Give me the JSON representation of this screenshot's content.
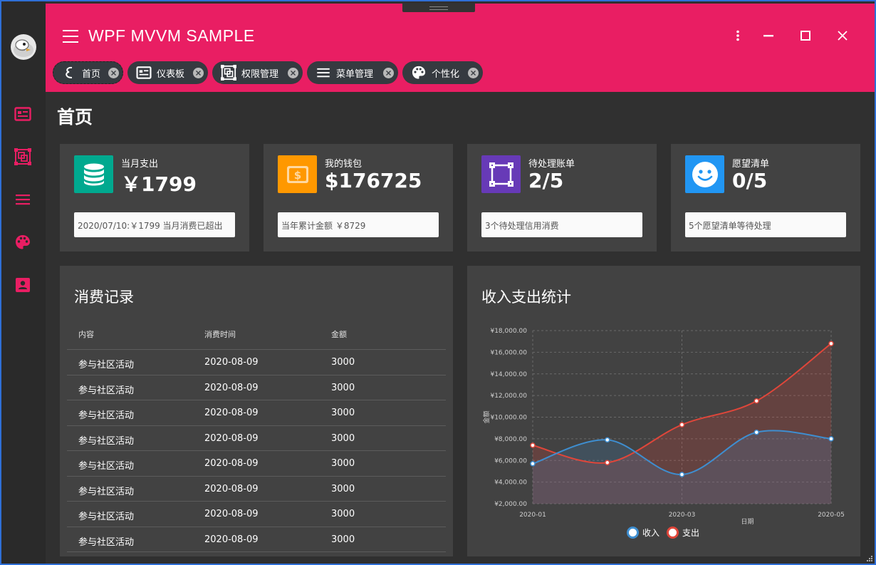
{
  "app": {
    "title": "WPF MVVM SAMPLE"
  },
  "colors": {
    "accent": "#e91e63",
    "card_teal": "#00a98f",
    "card_orange": "#ff9800",
    "card_purple": "#673ab7",
    "card_blue": "#2196f3",
    "income": "#3e8ed0",
    "expense": "#e0463a"
  },
  "sidebar": {
    "items": [
      {
        "icon": "dashboard-icon"
      },
      {
        "icon": "permission-icon"
      },
      {
        "icon": "menu-list-icon"
      },
      {
        "icon": "palette-icon"
      },
      {
        "icon": "account-box-icon"
      }
    ]
  },
  "tabs": [
    {
      "label": "首页",
      "icon": "home-icon"
    },
    {
      "label": "仪表板",
      "icon": "dashboard-icon"
    },
    {
      "label": "权限管理",
      "icon": "permission-icon"
    },
    {
      "label": "菜单管理",
      "icon": "menu-list-icon"
    },
    {
      "label": "个性化",
      "icon": "palette-icon"
    }
  ],
  "page": {
    "title": "首页"
  },
  "cards": [
    {
      "label": "当月支出",
      "value": "￥1799",
      "note": "2020/07/10:￥1799 当月消费已超出",
      "icon": "database-icon"
    },
    {
      "label": "我的钱包",
      "value": "$176725",
      "note": "当年累计金额 ￥8729",
      "icon": "wallet-icon"
    },
    {
      "label": "待处理账单",
      "value": "2/5",
      "note": "3个待处理信用消费",
      "icon": "bill-frame-icon"
    },
    {
      "label": "愿望清单",
      "value": "0/5",
      "note": "5个愿望清单等待处理",
      "icon": "smiley-icon"
    }
  ],
  "records": {
    "title": "消费记录",
    "headers": [
      "内容",
      "消费时间",
      "金额"
    ],
    "rows": [
      [
        "参与社区活动",
        "2020-08-09",
        "3000"
      ],
      [
        "参与社区活动",
        "2020-08-09",
        "3000"
      ],
      [
        "参与社区活动",
        "2020-08-09",
        "3000"
      ],
      [
        "参与社区活动",
        "2020-08-09",
        "3000"
      ],
      [
        "参与社区活动",
        "2020-08-09",
        "3000"
      ],
      [
        "参与社区活动",
        "2020-08-09",
        "3000"
      ],
      [
        "参与社区活动",
        "2020-08-09",
        "3000"
      ],
      [
        "参与社区活动",
        "2020-08-09",
        "3000"
      ]
    ]
  },
  "stats": {
    "title": "收入支出统计"
  },
  "chart_data": {
    "type": "area",
    "x": [
      "2020-01",
      "2020-02",
      "2020-03",
      "2020-04",
      "2020-05"
    ],
    "x_tick_labels": [
      "2020-01",
      "2020-03",
      "2020-05"
    ],
    "series": [
      {
        "name": "收入",
        "values": [
          5700,
          7900,
          4700,
          8600,
          8000
        ]
      },
      {
        "name": "支出",
        "values": [
          7400,
          5800,
          9300,
          11500,
          16800
        ]
      }
    ],
    "y_tick_labels": [
      "¥2,000.00",
      "¥4,000.00",
      "¥6,000.00",
      "¥8,000.00",
      "¥10,000.00",
      "¥12,000.00",
      "¥14,000.00",
      "¥16,000.00",
      "¥18,000.00"
    ],
    "xlabel": "日期",
    "ylabel": "金额",
    "ylim": [
      2000,
      18000
    ],
    "grid": true,
    "legend": "bottom"
  }
}
